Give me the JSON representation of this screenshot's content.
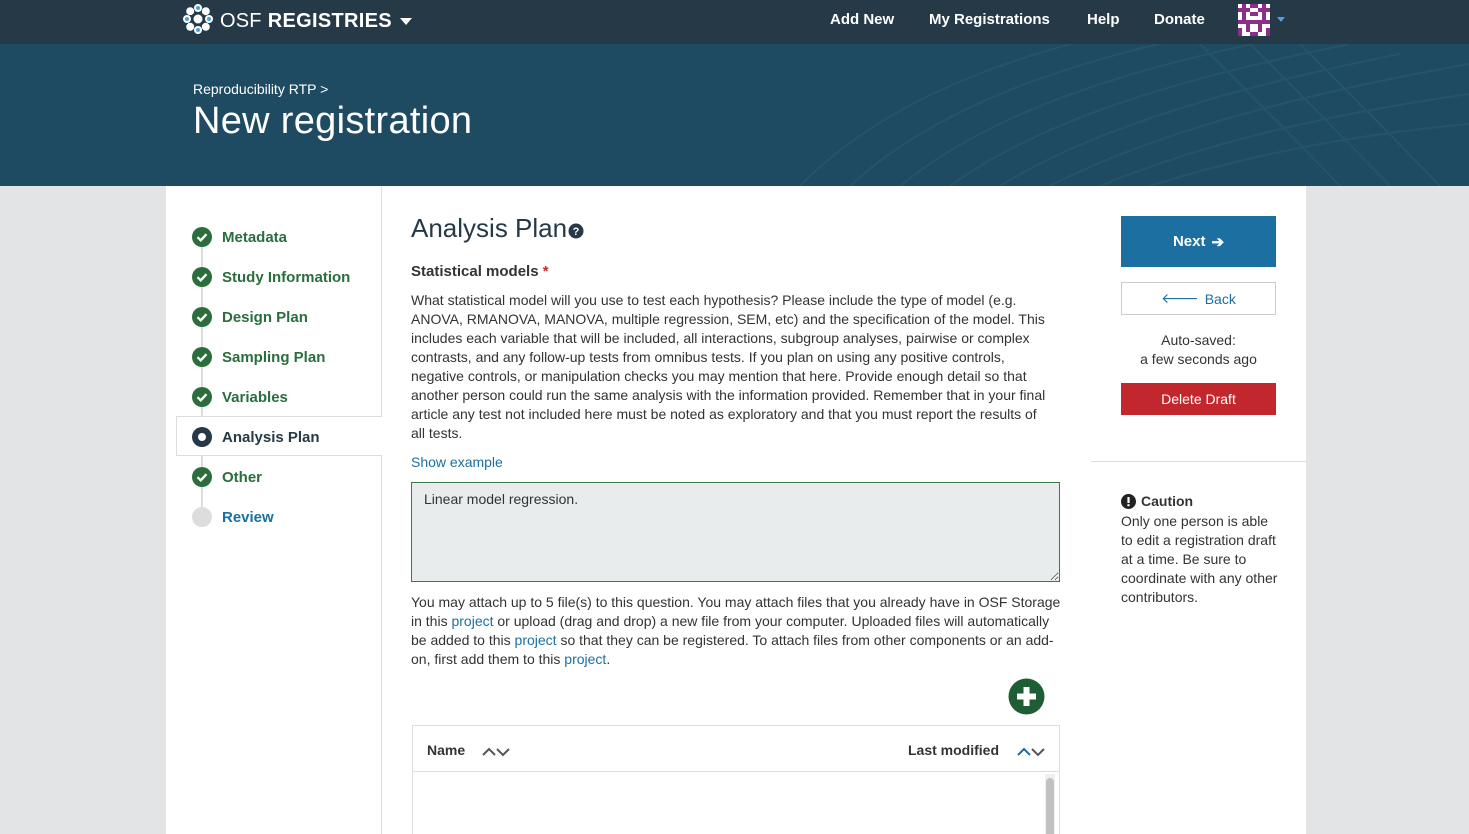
{
  "nav": {
    "brand_light": "OSF",
    "brand_bold": "REGISTRIES",
    "links": [
      "Add New",
      "My Registrations",
      "Help",
      "Donate"
    ]
  },
  "header": {
    "breadcrumb": "Reproducibility RTP >",
    "title": "New registration"
  },
  "steps": [
    {
      "label": "Metadata",
      "state": "complete"
    },
    {
      "label": "Study Information",
      "state": "complete"
    },
    {
      "label": "Design Plan",
      "state": "complete"
    },
    {
      "label": "Sampling Plan",
      "state": "complete"
    },
    {
      "label": "Variables",
      "state": "complete"
    },
    {
      "label": "Analysis Plan",
      "state": "current"
    },
    {
      "label": "Other",
      "state": "complete"
    },
    {
      "label": "Review",
      "state": "pending"
    }
  ],
  "main": {
    "heading": "Analysis Plan",
    "question_label": "Statistical models",
    "required_mark": "*",
    "question_description": "What statistical model will you use to test each hypothesis? Please include the type of model (e.g. ANOVA, RMANOVA, MANOVA, multiple regression, SEM, etc) and the specification of the model. This includes each variable that will be included, all interactions, subgroup analyses, pairwise or complex contrasts, and any follow-up tests from omnibus tests. If you plan on using any positive controls, negative controls, or manipulation checks you may mention that here. Provide enough detail so that another person could run the same analysis with the information provided. Remember that in your final article any test not included here must be noted as exploratory and that you must report the results of all tests.",
    "show_example": "Show example",
    "answer_value": "Linear model regression.",
    "attach_parts": [
      "You may attach up to 5 file(s) to this question. You may attach files that you already have in OSF Storage in this ",
      "project",
      " or upload (drag and drop) a new file from your computer. Uploaded files will automatically be added to this ",
      "project",
      " so that they can be registered. To attach files from other components or an add-on, first add them to this ",
      "project",
      "."
    ],
    "file_table": {
      "col_name": "Name",
      "col_modified": "Last modified"
    }
  },
  "right": {
    "next_label": "Next",
    "back_label": "Back",
    "autosave_line1": "Auto-saved:",
    "autosave_line2": "a few seconds ago",
    "delete_label": "Delete Draft",
    "caution_title": "Caution",
    "caution_text": "Only one person is able to edit a registration draft at a time. Be sure to coordinate with any other contributors."
  },
  "colors": {
    "nav_bg": "#263947",
    "hero_bg": "#1f4b62",
    "step_complete": "#2a6e3d",
    "link": "#1b6fa1",
    "primary": "#1b6fa1",
    "danger": "#c1272d"
  },
  "icons": {
    "brand": "osf-logo-icon",
    "help": "question-circle-icon",
    "add": "plus-circle-icon",
    "caution": "exclamation-circle-icon"
  }
}
